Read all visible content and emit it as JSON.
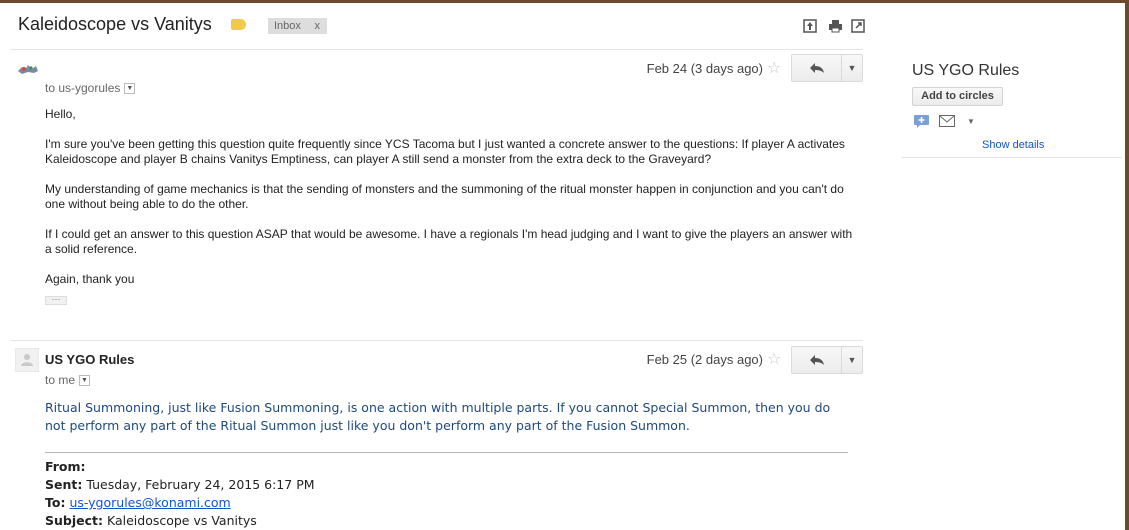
{
  "thread": {
    "subject": "Kaleidoscope vs Vanitys",
    "label_chip": "Inbox",
    "label_chip_close": "x"
  },
  "toolbar_icons": [
    "expand-all-icon",
    "print-icon",
    "new-window-icon"
  ],
  "messages": [
    {
      "sender": "",
      "to": "to us-ygorules",
      "date": "Feb 24 (3 days ago)",
      "paragraphs": [
        "Hello,",
        "I'm sure you've been getting this question quite frequently since YCS Tacoma but I just wanted a concrete answer to the questions: If player A activates Kaleidoscope and player B chains Vanitys Emptiness, can player A still send a monster from the extra deck to the Graveyard?",
        "My understanding of game mechanics is that the sending of monsters and the summoning of the ritual monster happen in conjunction and you can't do one without being able to do the other.",
        "If I could get an answer to this question ASAP that would be awesome. I have a regionals I'm head judging and I want to give the players an answer with a solid reference.",
        "Again, thank you"
      ],
      "trimmed_content": "···"
    },
    {
      "sender": "US YGO Rules",
      "to": "to me",
      "date": "Feb 25 (2 days ago)",
      "reply_text": "Ritual Summoning, just like Fusion Summoning, is one action with multiple parts. If you cannot Special Summon, then you do not perform any part of the Ritual Summon just like you don't perform any part of the Fusion Summon.",
      "quoted": {
        "from_label": "From:",
        "from_value": "",
        "sent_label": "Sent:",
        "sent_value": "Tuesday, February 24, 2015 6:17 PM",
        "to_label": "To:",
        "to_value": "us-ygorules@konami.com",
        "subject_label": "Subject:",
        "subject_value": "Kaleidoscope vs Vanitys"
      }
    }
  ],
  "sidebar": {
    "contact_name": "US YGO Rules",
    "add_to_circles": "Add to circles",
    "show_details": "Show details"
  },
  "colors": {
    "reply_text": "#1f497d",
    "link": "#1155cc",
    "label_tag": "#f2c94c",
    "frame": "#6b4a2e"
  }
}
